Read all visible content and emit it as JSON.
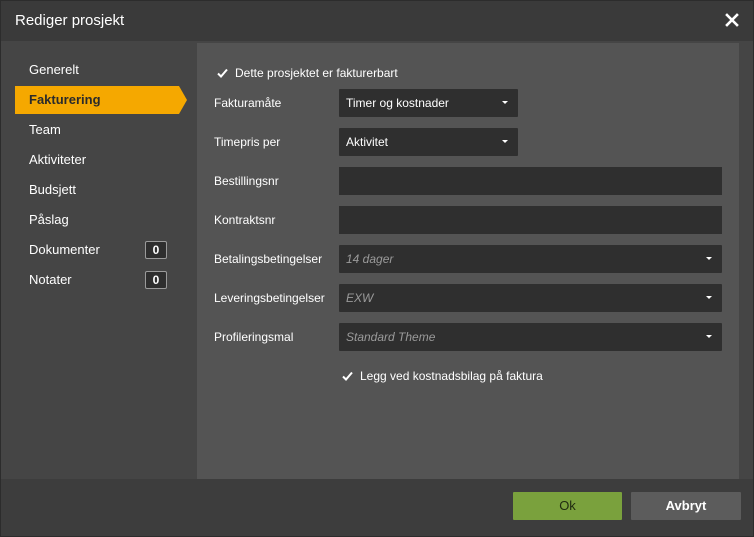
{
  "dialog": {
    "title": "Rediger prosjekt",
    "close_icon": "close-icon"
  },
  "sidebar": {
    "items": [
      {
        "label": "Generelt",
        "active": false
      },
      {
        "label": "Fakturering",
        "active": true
      },
      {
        "label": "Team",
        "active": false
      },
      {
        "label": "Aktiviteter",
        "active": false
      },
      {
        "label": "Budsjett",
        "active": false
      },
      {
        "label": "Påslag",
        "active": false
      },
      {
        "label": "Dokumenter",
        "active": false,
        "badge": "0"
      },
      {
        "label": "Notater",
        "active": false,
        "badge": "0"
      }
    ]
  },
  "form": {
    "billable": {
      "label": "Dette prosjektet er fakturerbart",
      "checked": true
    },
    "invoice_method": {
      "label": "Fakturamåte",
      "value": "Timer og kostnader"
    },
    "hourly_rate": {
      "label": "Timepris per",
      "value": "Aktivitet"
    },
    "order_no": {
      "label": "Bestillingsnr",
      "value": ""
    },
    "contract_no": {
      "label": "Kontraktsnr",
      "value": ""
    },
    "payment_terms": {
      "label": "Betalingsbetingelser",
      "placeholder": "14 dager"
    },
    "delivery_terms": {
      "label": "Leveringsbetingelser",
      "placeholder": "EXW"
    },
    "profile_template": {
      "label": "Profileringsmal",
      "placeholder": "Standard Theme"
    },
    "attach_receipts": {
      "label": "Legg ved kostnadsbilag på faktura",
      "checked": true
    }
  },
  "footer": {
    "ok_label": "Ok",
    "cancel_label": "Avbryt"
  },
  "colors": {
    "accent": "#f5a800",
    "ok_button": "#7aa13d",
    "panel": "#545454",
    "field": "#2f2f2f"
  }
}
